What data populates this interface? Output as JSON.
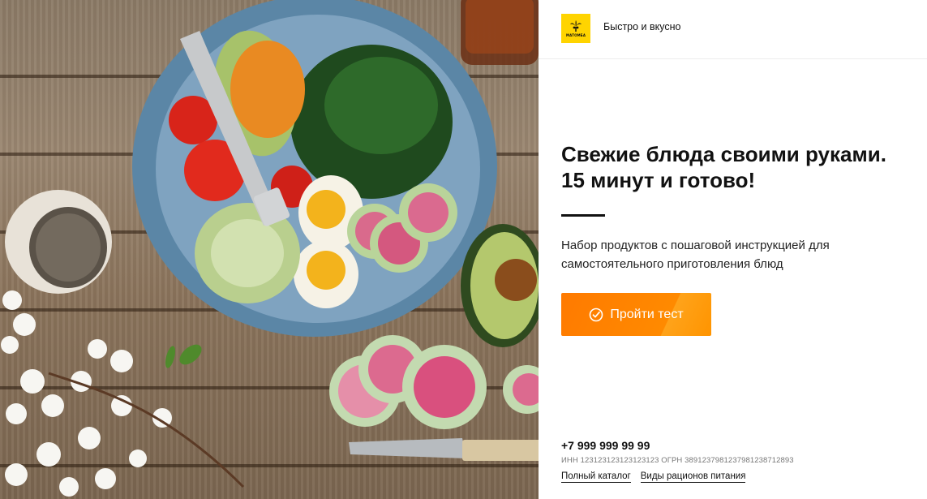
{
  "header": {
    "logo_text": "МАТОМБА",
    "tagline": "Быстро и вкусно"
  },
  "hero": {
    "title": "Свежие блюда своими руками. 15 минут и готово!",
    "subtitle": "Набор продуктов с пошаговой инструкцией для самостоятельного приготовления блюд",
    "cta_label": "Пройти тест",
    "cta_icon": "check-circle-icon"
  },
  "footer": {
    "phone": "+7 999 999 99 99",
    "legal": "ИНН 123123123123123123 ОГРН 3891237981237981238712893",
    "links": [
      "Полный каталог",
      "Виды рационов питания"
    ]
  },
  "colors": {
    "accent": "#ff8000",
    "logo_bg": "#ffd400",
    "text": "#111111"
  }
}
